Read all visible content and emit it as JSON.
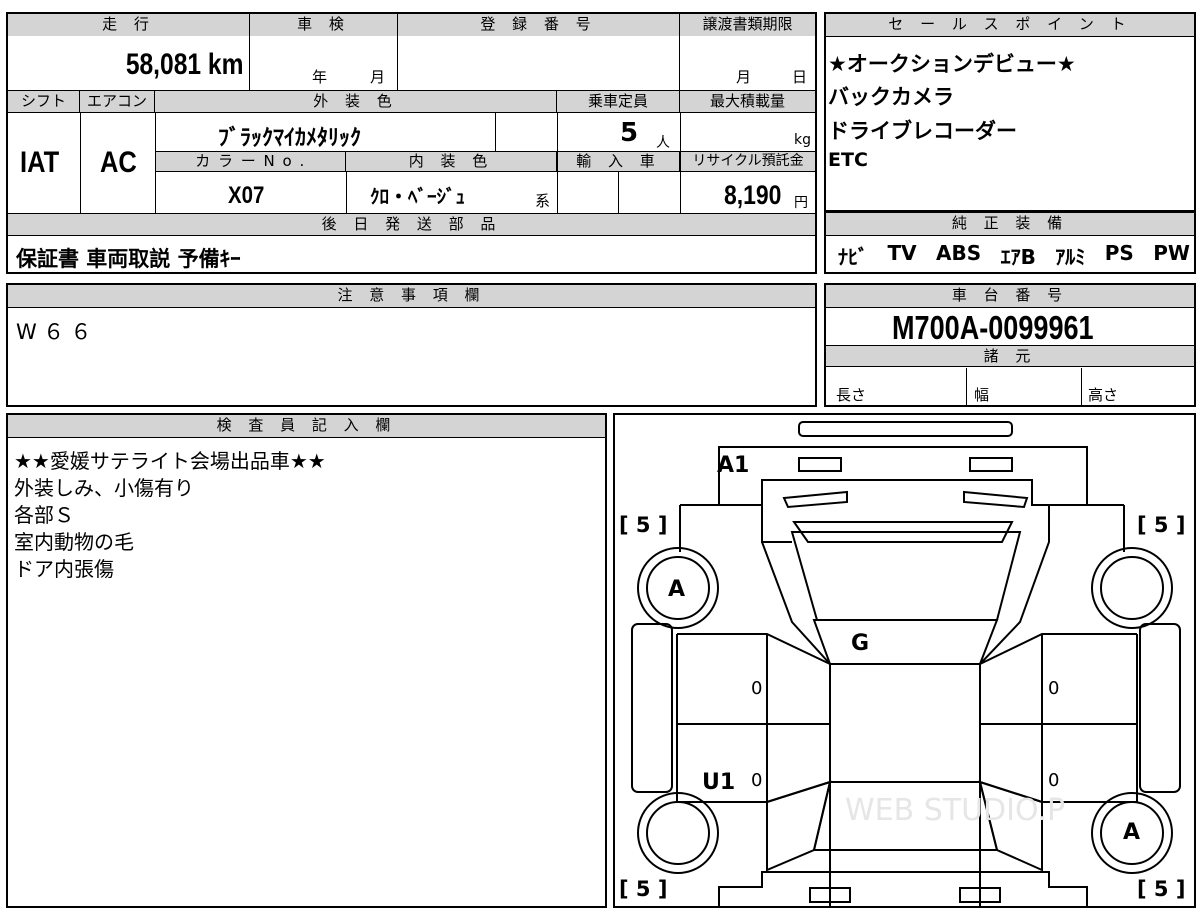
{
  "specs": {
    "mileage_label": "走 行",
    "mileage_value": "58,081 km",
    "inspection_label": "車 検",
    "inspection_year": "年",
    "inspection_month": "月",
    "registration_label": "登 録 番 号",
    "transfer_deadline_label": "譲渡書類期限",
    "transfer_month": "月",
    "transfer_day": "日",
    "shift_label": "シフト",
    "shift_value": "IAT",
    "ac_label": "エアコン",
    "ac_value": "AC",
    "exterior_color_label": "外 装 色",
    "exterior_color_value": "ﾌﾞﾗｯｸﾏｲｶﾒﾀﾘｯｸ",
    "capacity_label": "乗車定員",
    "capacity_value": "5",
    "capacity_unit": "人",
    "max_load_label": "最大積載量",
    "max_load_unit": "kg",
    "color_no_label": "カ ラ ー N o .",
    "color_no_value": "X07",
    "interior_color_label": "内 装 色",
    "interior_color_value": "ｸﾛ・ﾍﾞｰｼﾞｭ",
    "interior_suffix": "系",
    "import_label": "輸 入 車",
    "recycle_label": "リサイクル預託金",
    "recycle_value": "8,190",
    "recycle_unit": "円",
    "later_parts_label": "後 日 発 送 部 品",
    "later_parts_value": "保証書 車両取説 予備ｷｰ"
  },
  "sales_points": {
    "header": "セ ー ル ス ポ イ ン ト",
    "items": [
      "★オークションデビュー★",
      "バックカメラ",
      "ドライブレコーダー",
      "ETC"
    ]
  },
  "genuine_equipment": {
    "header": "純 正 装 備",
    "items": [
      "ﾅﾋﾞ",
      "TV",
      "ABS",
      "ｴｱB",
      "ｱﾙﾐ",
      "PS",
      "PW"
    ]
  },
  "notes": {
    "header": "注 意 事 項 欄",
    "value": "W６６"
  },
  "chassis": {
    "header": "車 台 番 号",
    "value": "M700A-0099961",
    "specs_header": "諸 元",
    "length_label": "長さ",
    "width_label": "幅",
    "height_label": "高さ"
  },
  "inspector": {
    "header": "検 査 員 記 入 欄",
    "lines": [
      "★★愛媛サテライト会場出品車★★",
      "外装しみ、小傷有り",
      "各部Ｓ",
      "室内動物の毛",
      "ドア内張傷"
    ]
  },
  "diagram": {
    "tire_tread": "[ 5 ]",
    "marks": [
      "A1",
      "A",
      "G",
      "0",
      "U1",
      "A"
    ],
    "watermark": "WEB STUDIO.P"
  }
}
